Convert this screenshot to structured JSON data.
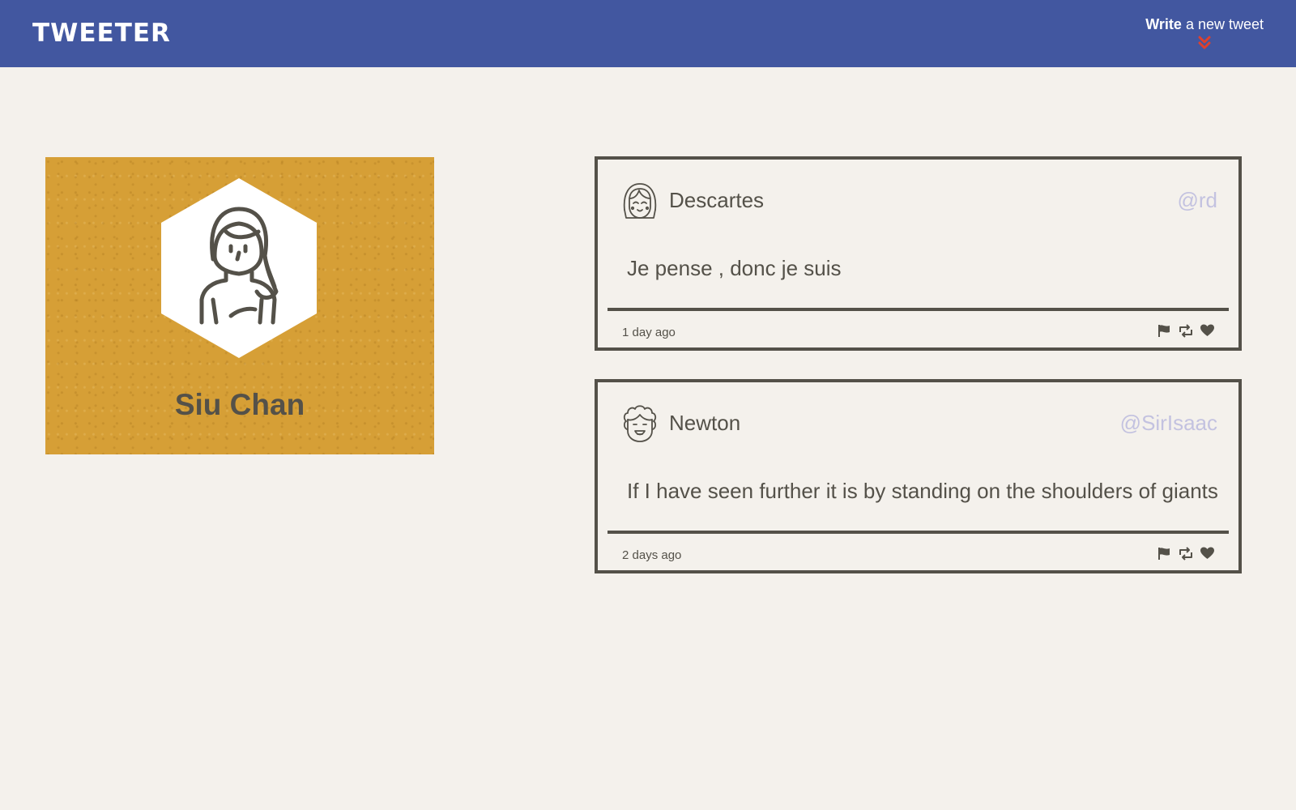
{
  "header": {
    "brand": "TWEETER",
    "compose": {
      "strong": "Write",
      "rest": " a new tweet",
      "arrow_icon": "double-chevron-down-icon",
      "arrow_color": "#e0402c"
    },
    "background": "#4257a0"
  },
  "profile": {
    "name": "Siu Chan",
    "avatar_icon": "woman-avatar-icon",
    "background": "#d69f36"
  },
  "tweets": [
    {
      "name": "Descartes",
      "handle": "@rd",
      "text": "Je pense , donc je suis",
      "time": "1 day ago",
      "avatar_icon": "girl-avatar-icon",
      "actions": [
        "flag-icon",
        "retweet-icon",
        "heart-icon"
      ]
    },
    {
      "name": "Newton",
      "handle": "@SirIsaac",
      "text": "If I have seen further it is by standing on the shoulders of giants",
      "time": "2 days ago",
      "avatar_icon": "curly-hair-avatar-icon",
      "actions": [
        "flag-icon",
        "retweet-icon",
        "heart-icon"
      ]
    }
  ],
  "colors": {
    "page_background": "#f4f1ec",
    "text": "#545149",
    "handle": "#c3c2e0"
  }
}
